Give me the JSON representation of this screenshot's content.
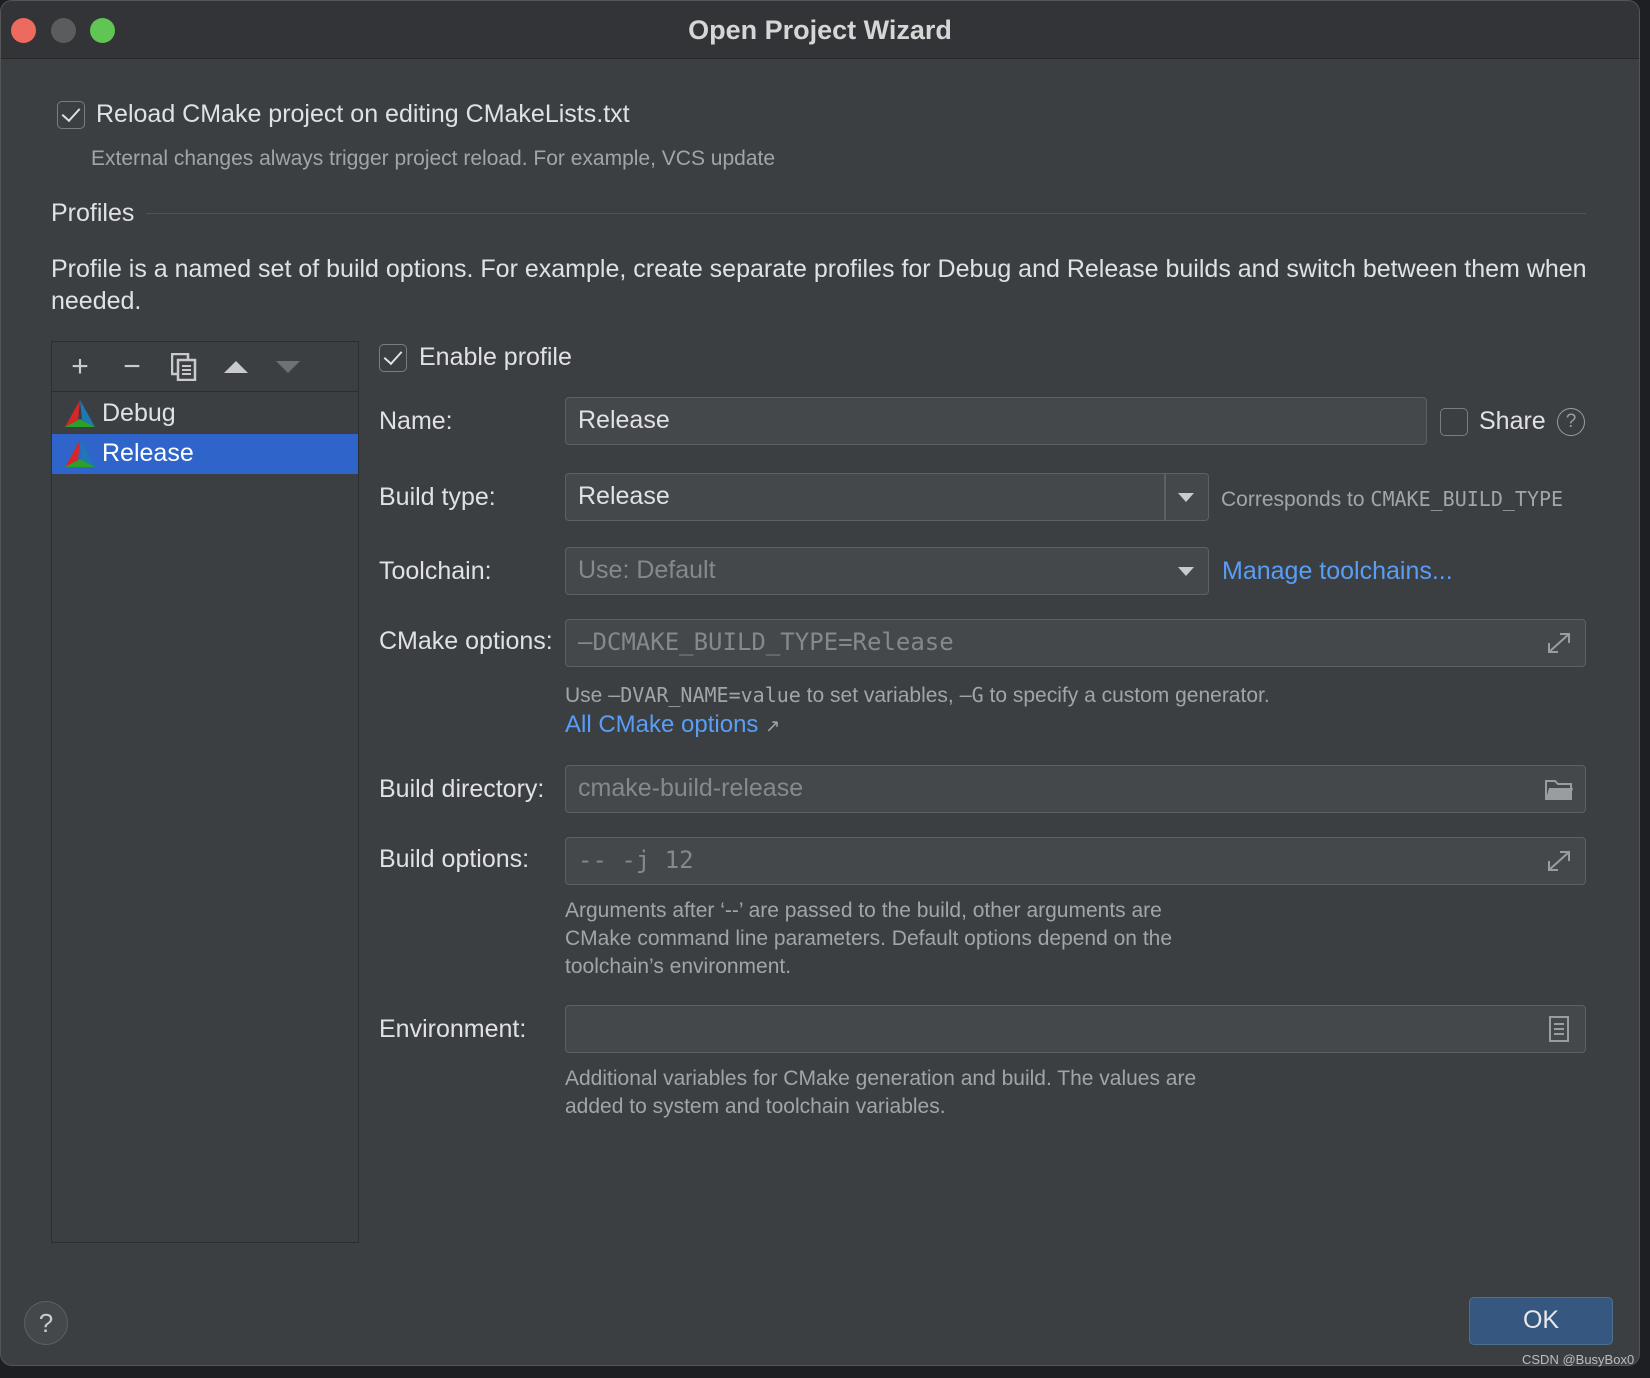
{
  "window": {
    "title": "Open Project Wizard"
  },
  "reload": {
    "checked": true,
    "label": "Reload CMake project on editing CMakeLists.txt",
    "hint": "External changes always trigger project reload. For example, VCS update"
  },
  "profiles": {
    "section_title": "Profiles",
    "description_line1": "Profile is a named set of build options. For example, create separate profiles for Debug and Release builds and switch between them when",
    "description_line2": "needed.",
    "items": [
      {
        "label": "Debug",
        "selected": false
      },
      {
        "label": "Release",
        "selected": true
      }
    ],
    "toolbar": {
      "add": "+",
      "remove": "−"
    }
  },
  "form": {
    "enable_profile": {
      "checked": true,
      "label": "Enable profile"
    },
    "name": {
      "label": "Name:",
      "value": "Release"
    },
    "share": {
      "checked": false,
      "label": "Share",
      "help": "?"
    },
    "build_type": {
      "label": "Build type:",
      "value": "Release",
      "hint_prefix": "Corresponds to ",
      "hint_code": "CMAKE_BUILD_TYPE"
    },
    "toolchain": {
      "label": "Toolchain:",
      "value": "Use: Default",
      "link": "Manage toolchains..."
    },
    "cmake_options": {
      "label": "CMake options:",
      "placeholder": "–DCMAKE_BUILD_TYPE=Release",
      "hint_use": "Use ",
      "hint_code1": "–DVAR_NAME=value",
      "hint_mid": " to set variables, ",
      "hint_code2": "–G",
      "hint_end": " to specify a custom generator.",
      "link": "All CMake options",
      "link_arrow": "↗"
    },
    "build_directory": {
      "label": "Build directory:",
      "placeholder": "cmake-build-release"
    },
    "build_options": {
      "label": "Build options:",
      "placeholder": "-- -j 12",
      "hint_line1": "Arguments after ‘--’ are passed to the build, other arguments are",
      "hint_line2": "CMake command line parameters. Default options depend on the",
      "hint_line3": "toolchain’s environment."
    },
    "environment": {
      "label": "Environment:",
      "value": "",
      "hint_line1": "Additional variables for CMake generation and build. The values are",
      "hint_line2": "added to system and toolchain variables."
    }
  },
  "footer": {
    "help": "?",
    "ok": "OK",
    "watermark": "CSDN @BusyBox0"
  }
}
